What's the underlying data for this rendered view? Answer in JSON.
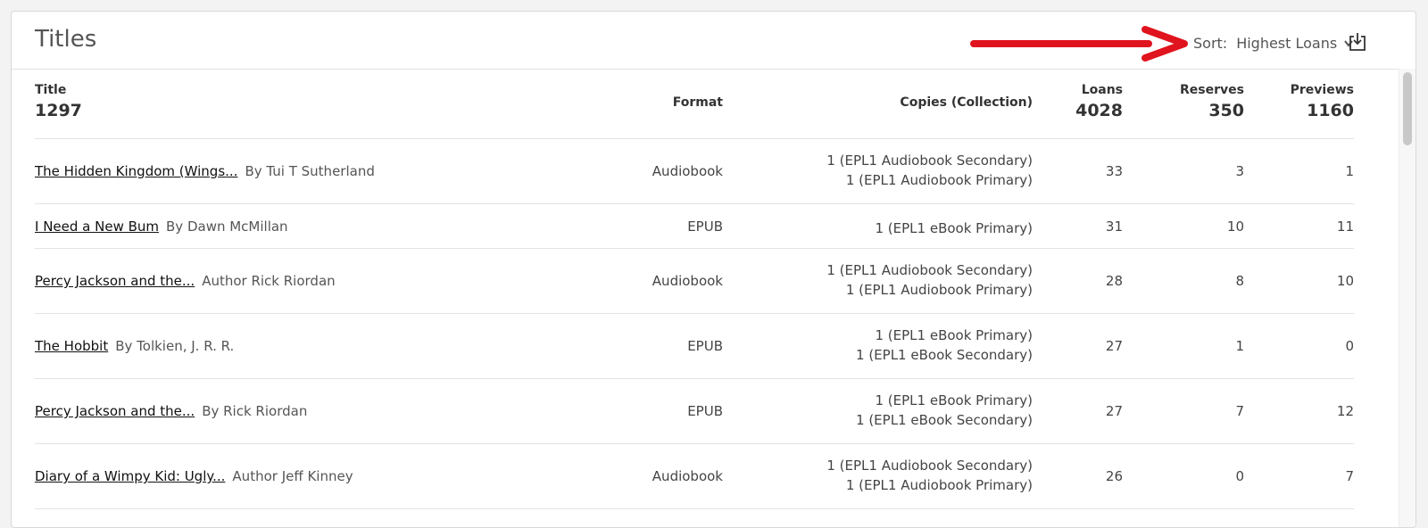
{
  "header": {
    "title": "Titles",
    "sort_label": "Sort:",
    "sort_value": "Highest Loans"
  },
  "columns": {
    "title": "Title",
    "title_count": "1297",
    "format": "Format",
    "copies": "Copies (Collection)",
    "loans": "Loans",
    "loans_count": "4028",
    "reserves": "Reserves",
    "reserves_count": "350",
    "previews": "Previews",
    "previews_count": "1160"
  },
  "rows": [
    {
      "title": "The Hidden Kingdom (Wings...",
      "author": "By Tui T Sutherland",
      "format": "Audiobook",
      "copies": [
        "1 (EPL1 Audiobook Secondary)",
        "1 (EPL1 Audiobook Primary)"
      ],
      "loans": "33",
      "reserves": "3",
      "previews": "1"
    },
    {
      "title": "I Need a New Bum",
      "author": "By Dawn McMillan",
      "format": "EPUB",
      "copies": [
        "1 (EPL1 eBook Primary)"
      ],
      "loans": "31",
      "reserves": "10",
      "previews": "11"
    },
    {
      "title": "Percy Jackson and the...",
      "author": "Author Rick Riordan",
      "format": "Audiobook",
      "copies": [
        "1 (EPL1 Audiobook Secondary)",
        "1 (EPL1 Audiobook Primary)"
      ],
      "loans": "28",
      "reserves": "8",
      "previews": "10"
    },
    {
      "title": "The Hobbit",
      "author": "By Tolkien, J. R. R.",
      "format": "EPUB",
      "copies": [
        "1 (EPL1 eBook Primary)",
        "1 (EPL1 eBook Secondary)"
      ],
      "loans": "27",
      "reserves": "1",
      "previews": "0"
    },
    {
      "title": "Percy Jackson and the...",
      "author": "By Rick Riordan",
      "format": "EPUB",
      "copies": [
        "1 (EPL1 eBook Primary)",
        "1 (EPL1 eBook Secondary)"
      ],
      "loans": "27",
      "reserves": "7",
      "previews": "12"
    },
    {
      "title": "Diary of a Wimpy Kid: Ugly...",
      "author": "Author Jeff Kinney",
      "format": "Audiobook",
      "copies": [
        "1 (EPL1 Audiobook Secondary)",
        "1 (EPL1 Audiobook Primary)"
      ],
      "loans": "26",
      "reserves": "0",
      "previews": "7"
    }
  ],
  "colors": {
    "accent_arrow": "#e0141e",
    "border": "#e2e2e2"
  },
  "icons": {
    "sort_chevron": "chevron-down-icon",
    "download": "download-icon",
    "annotation": "red-arrow-annotation"
  }
}
